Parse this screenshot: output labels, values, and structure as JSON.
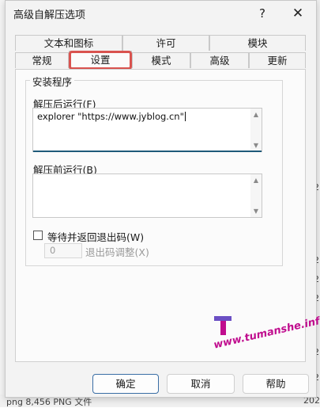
{
  "dialog": {
    "title": "高级自解压选项",
    "help_label": "?",
    "close_label": "✕"
  },
  "tabs": {
    "row_top": [
      {
        "label": "文本和图标"
      },
      {
        "label": "许可"
      },
      {
        "label": "模块"
      }
    ],
    "row_bottom": [
      {
        "label": "常规"
      },
      {
        "label": "设置",
        "active": true
      },
      {
        "label": "模式"
      },
      {
        "label": "高级"
      },
      {
        "label": "更新"
      }
    ]
  },
  "setup": {
    "group_label": "安装程序",
    "run_after_label": "解压后运行(F)",
    "run_after_value": "explorer \"https://www.jyblog.cn\"",
    "run_before_label": "解压前运行(B)",
    "run_before_value": "",
    "wait_checkbox_label": "等待并返回退出码(W)",
    "wait_checked": false,
    "exit_code_value": "0",
    "exit_code_label": "退出码调整(X)"
  },
  "buttons": {
    "ok": "确定",
    "cancel": "取消",
    "help": "帮助"
  },
  "watermark": {
    "logo_letter": "T",
    "text": "www.tumanshe.info",
    "color": "#c00d8e"
  },
  "background": {
    "right_edge_values": [
      "2",
      "2",
      "2",
      "2",
      "2",
      "2"
    ],
    "bottom_text": "png            8,456   PNG 文件",
    "bottom_right": "202"
  },
  "colors": {
    "highlight": "#d9534f",
    "focus": "#1f5a7a"
  }
}
